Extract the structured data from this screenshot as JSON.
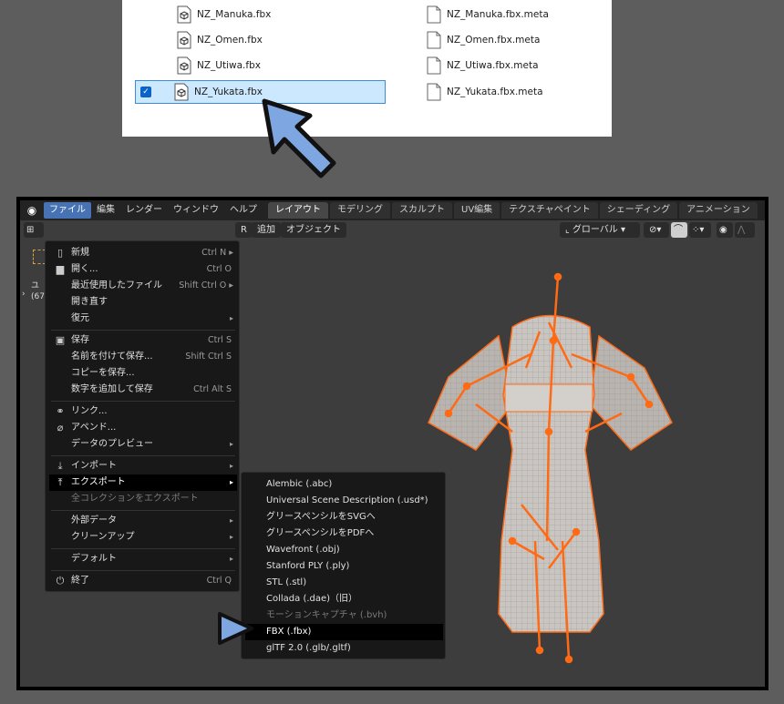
{
  "explorer": {
    "left_files": [
      {
        "name": "NZ_Manuka.fbx",
        "selected": false
      },
      {
        "name": "NZ_Omen.fbx",
        "selected": false
      },
      {
        "name": "NZ_Utiwa.fbx",
        "selected": false
      },
      {
        "name": "NZ_Yukata.fbx",
        "selected": true
      }
    ],
    "right_files": [
      {
        "name": "NZ_Manuka.fbx.meta"
      },
      {
        "name": "NZ_Omen.fbx.meta"
      },
      {
        "name": "NZ_Utiwa.fbx.meta"
      },
      {
        "name": "NZ_Yukata.fbx.meta"
      }
    ]
  },
  "topbar": {
    "menus": [
      "ファイル",
      "編集",
      "レンダー",
      "ウィンドウ",
      "ヘルプ"
    ],
    "workspace_tabs": [
      "レイアウト",
      "モデリング",
      "スカルプト",
      "UV編集",
      "テクスチャペイント",
      "シェーディング",
      "アニメーション"
    ]
  },
  "viewport_header": {
    "add_label": "追加",
    "object_label": "オブジェクト",
    "partial_r": "R",
    "orientation_label": "グローバル",
    "side_text_1": "ユ",
    "side_text_2": "(67"
  },
  "file_menu": {
    "items": [
      {
        "label": "新規",
        "shortcut": "Ctrl N",
        "icon": "new-file-icon",
        "submenu": true
      },
      {
        "label": "開く...",
        "shortcut": "Ctrl O",
        "icon": "folder-icon",
        "submenu": false
      },
      {
        "label": "最近使用したファイル",
        "shortcut": "Shift Ctrl O",
        "icon": "",
        "submenu": true
      },
      {
        "label": "開き直す",
        "shortcut": "",
        "icon": "",
        "submenu": false
      },
      {
        "label": "復元",
        "shortcut": "",
        "icon": "",
        "submenu": true
      },
      {
        "label": "保存",
        "shortcut": "Ctrl S",
        "icon": "save-icon",
        "submenu": false
      },
      {
        "label": "名前を付けて保存...",
        "shortcut": "Shift Ctrl S",
        "icon": "",
        "submenu": false
      },
      {
        "label": "コピーを保存...",
        "shortcut": "",
        "icon": "",
        "submenu": false
      },
      {
        "label": "数字を追加して保存",
        "shortcut": "Ctrl Alt S",
        "icon": "",
        "submenu": false
      },
      {
        "label": "リンク...",
        "shortcut": "",
        "icon": "link-icon",
        "submenu": false
      },
      {
        "label": "アペンド...",
        "shortcut": "",
        "icon": "append-icon",
        "submenu": false
      },
      {
        "label": "データのプレビュー",
        "shortcut": "",
        "icon": "",
        "submenu": true
      },
      {
        "label": "インポート",
        "shortcut": "",
        "icon": "import-icon",
        "submenu": true
      },
      {
        "label": "エクスポート",
        "shortcut": "",
        "icon": "export-icon",
        "submenu": true
      },
      {
        "label": "全コレクションをエクスポート",
        "shortcut": "",
        "icon": "",
        "submenu": false
      },
      {
        "label": "外部データ",
        "shortcut": "",
        "icon": "",
        "submenu": true
      },
      {
        "label": "クリーンアップ",
        "shortcut": "",
        "icon": "",
        "submenu": true
      },
      {
        "label": "デフォルト",
        "shortcut": "",
        "icon": "",
        "submenu": true
      },
      {
        "label": "終了",
        "shortcut": "Ctrl Q",
        "icon": "power-icon",
        "submenu": false
      }
    ]
  },
  "export_menu": {
    "items": [
      "Alembic (.abc)",
      "Universal Scene Description (.usd*)",
      "グリースペンシルをSVGへ",
      "グリースペンシルをPDFへ",
      "Wavefront (.obj)",
      "Stanford PLY (.ply)",
      "STL (.stl)",
      "Collada (.dae)（旧）",
      "モーションキャプチャ (.bvh)",
      "FBX (.fbx)",
      "glTF 2.0 (.glb/.gltf)"
    ]
  },
  "colors": {
    "accent": "#4772b3",
    "selection": "#cce8ff",
    "armature": "#ff6a14",
    "pointer_arrow": "#7ea6e0"
  }
}
